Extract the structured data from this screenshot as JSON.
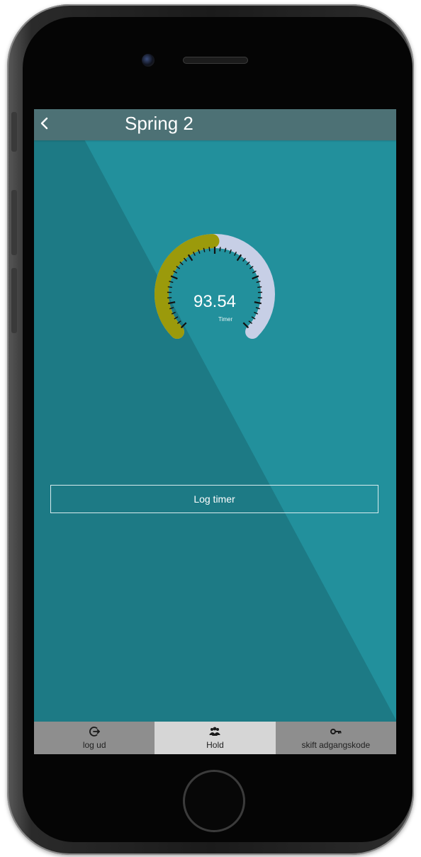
{
  "header": {
    "title": "Spring 2",
    "back_icon": "back-chevron-icon"
  },
  "gauge": {
    "value": "93.54",
    "unit": "Timer",
    "fill_fraction": 0.49,
    "colors": {
      "filled": "#9b9a0b",
      "remaining": "#c7cfe6"
    }
  },
  "actions": {
    "log_label": "Log timer"
  },
  "tabbar": {
    "items": [
      {
        "label": "log ud",
        "icon": "logout-icon",
        "active": false
      },
      {
        "label": "Hold",
        "icon": "team-icon",
        "active": true
      },
      {
        "label": "skift adgangskode",
        "icon": "key-icon",
        "active": false
      }
    ]
  },
  "colors": {
    "header": "#4d7175",
    "background_dark": "#1d7a85",
    "background_light": "#22909c",
    "tab_inactive": "#8e8e8e",
    "tab_active": "#d6d6d6"
  }
}
